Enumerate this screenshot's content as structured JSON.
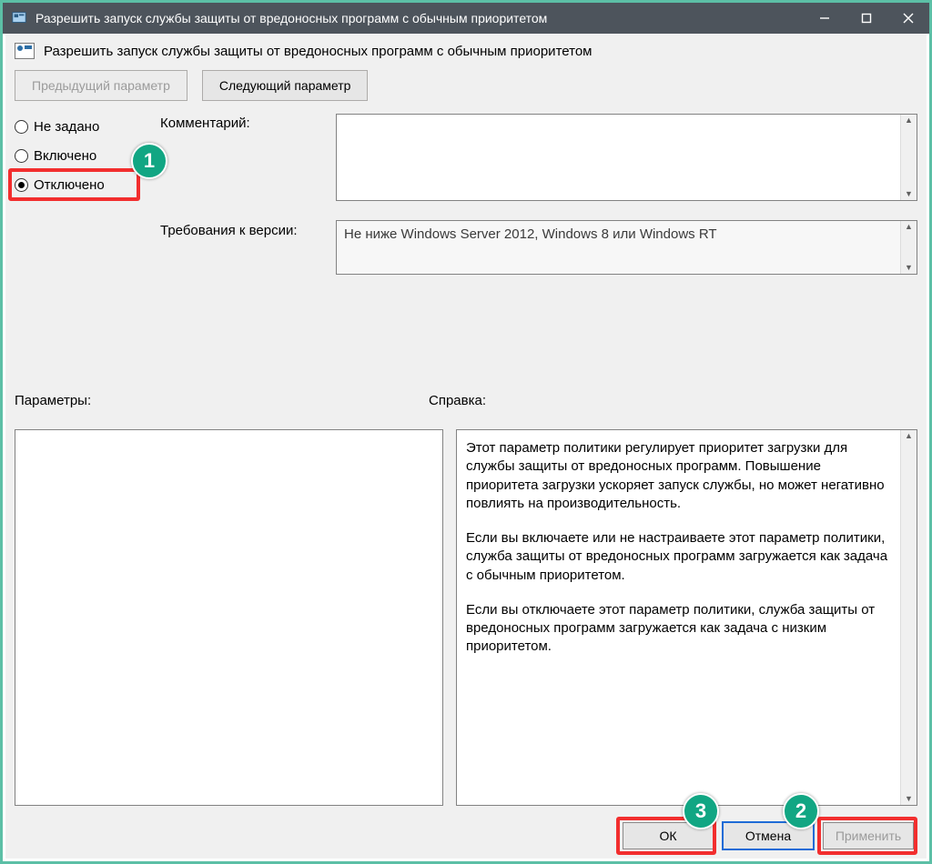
{
  "window": {
    "title": "Разрешить запуск службы защиты от вредоносных программ с обычным приоритетом"
  },
  "header": {
    "title": "Разрешить запуск службы защиты от вредоносных программ с обычным приоритетом",
    "prev_setting": "Предыдущий параметр",
    "next_setting": "Следующий параметр"
  },
  "state": {
    "options": {
      "not_configured": "Не задано",
      "enabled": "Включено",
      "disabled": "Отключено"
    },
    "selected": "disabled"
  },
  "labels": {
    "comment": "Комментарий:",
    "supported": "Требования к версии:",
    "options_pane": "Параметры:",
    "help_pane": "Справка:"
  },
  "supported_text": "Не ниже Windows Server 2012, Windows 8 или Windows RT",
  "help": {
    "p1": "Этот параметр политики регулирует приоритет загрузки для службы защиты от вредоносных программ. Повышение приоритета загрузки ускоряет запуск службы, но может негативно повлиять на производительность.",
    "p2": "Если вы включаете или не настраиваете этот параметр политики, служба защиты от вредоносных программ загружается как задача с обычным приоритетом.",
    "p3": "Если вы отключаете этот параметр политики, служба защиты от вредоносных программ загружается как задача с низким приоритетом."
  },
  "buttons": {
    "ok": "ОК",
    "cancel": "Отмена",
    "apply": "Применить"
  },
  "annotations": {
    "b1": "1",
    "b2": "2",
    "b3": "3"
  }
}
